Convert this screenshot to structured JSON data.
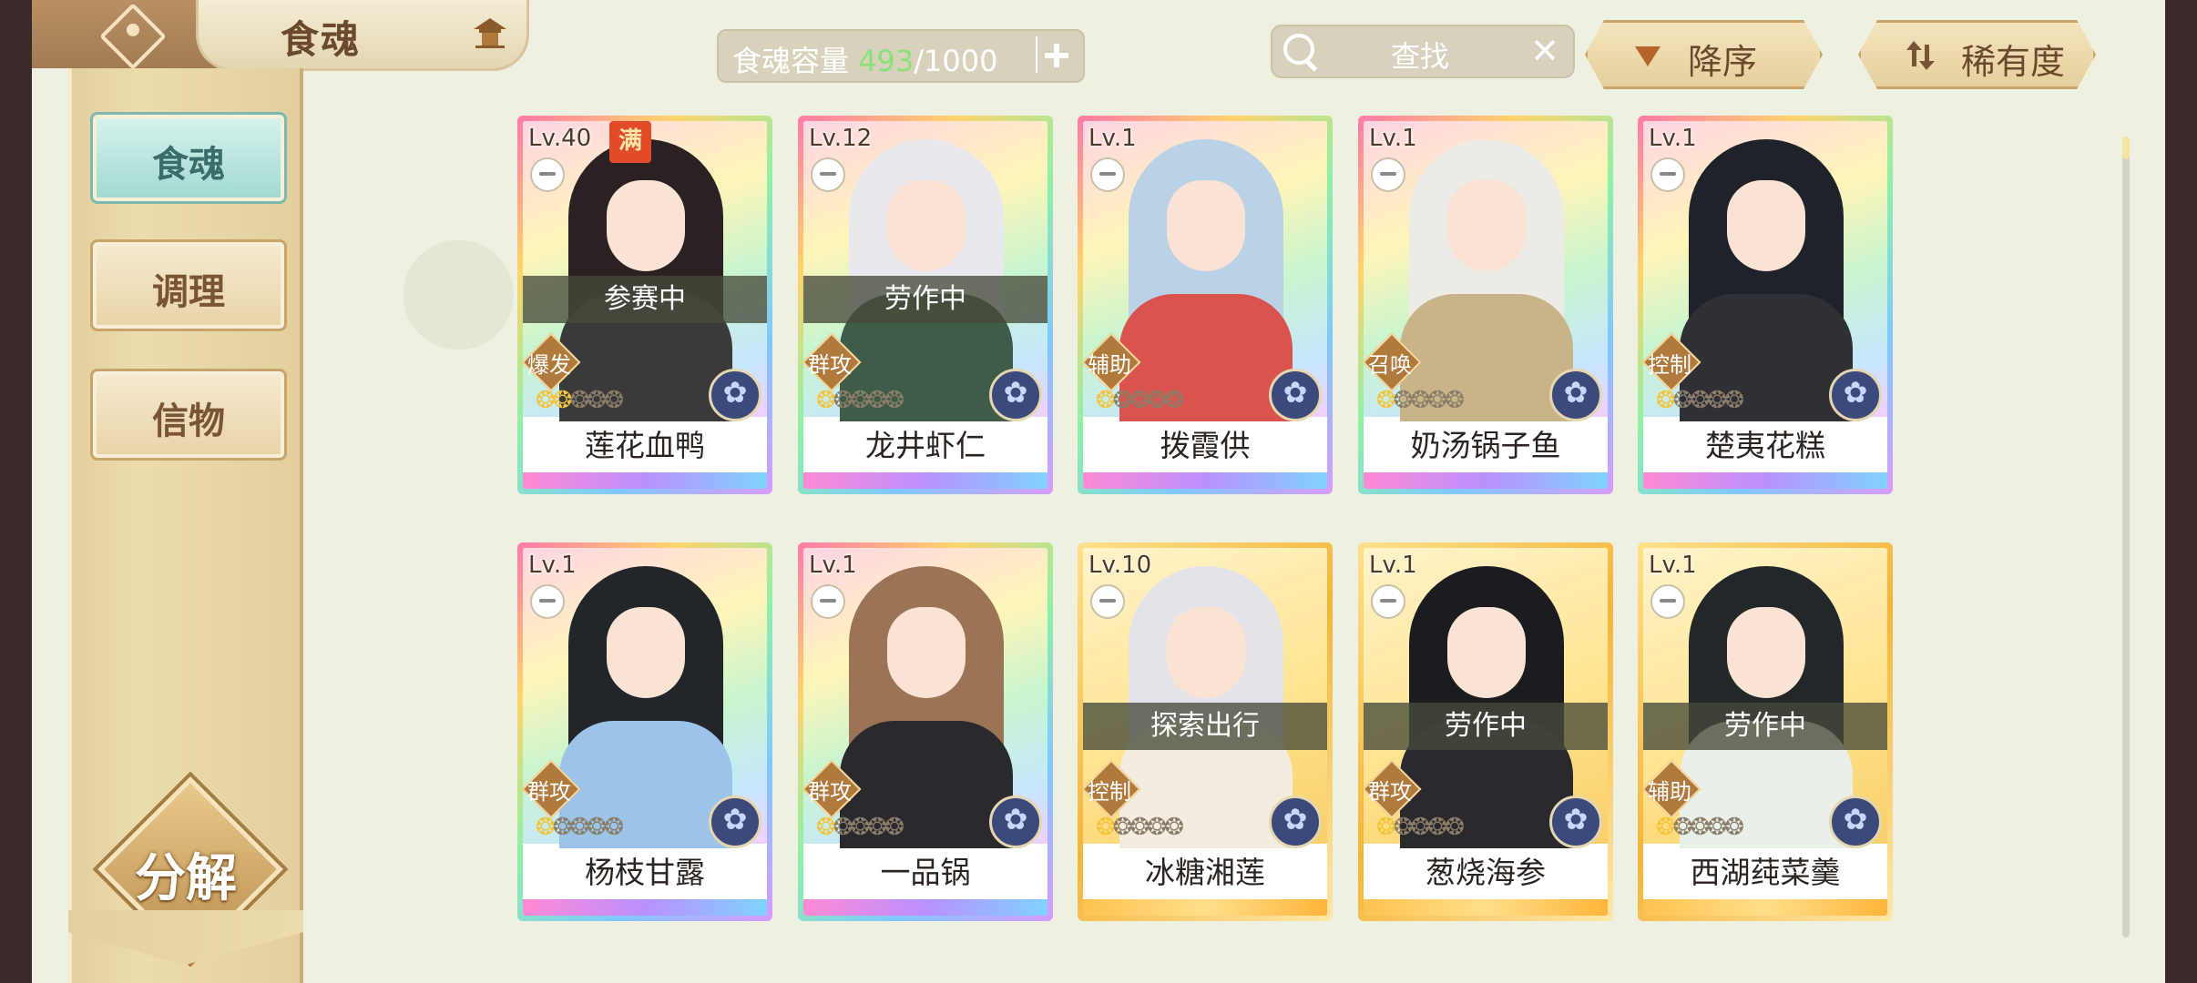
{
  "header": {
    "title": "食魂",
    "capacity_label": "食魂容量",
    "capacity_current": "493",
    "capacity_max": "/1000",
    "search_placeholder": "查找",
    "sort_order": "降序",
    "sort_by": "稀有度"
  },
  "sidebar": {
    "items": [
      {
        "label": "食魂",
        "active": true
      },
      {
        "label": "调理",
        "active": false
      },
      {
        "label": "信物",
        "active": false
      }
    ],
    "decompose": "分解"
  },
  "cards": [
    {
      "level": "Lv.40",
      "max_badge": "满",
      "status": "参赛中",
      "role": "爆发",
      "stars": 2,
      "name": "莲花血鸭",
      "frame": "rainbow",
      "hair": "#2a2222",
      "body": "#3a3a3a"
    },
    {
      "level": "Lv.12",
      "status": "劳作中",
      "role": "群攻",
      "stars": 1,
      "name": "龙井虾仁",
      "frame": "rainbow",
      "hair": "#e8e8ee",
      "body": "#3f5c48"
    },
    {
      "level": "Lv.1",
      "status": "",
      "role": "辅助",
      "stars": 1,
      "name": "拨霞供",
      "frame": "rainbow",
      "hair": "#b9d2e6",
      "body": "#d9534f"
    },
    {
      "level": "Lv.1",
      "status": "",
      "role": "召唤",
      "stars": 1,
      "name": "奶汤锅子鱼",
      "frame": "rainbow",
      "hair": "#ecebe6",
      "body": "#c9b48a"
    },
    {
      "level": "Lv.1",
      "status": "",
      "role": "控制",
      "stars": 1,
      "name": "楚夷花糕",
      "frame": "rainbow",
      "hair": "#1f2228",
      "body": "#2e3036"
    },
    {
      "level": "Lv.1",
      "status": "",
      "role": "群攻",
      "stars": 1,
      "name": "杨枝甘露",
      "frame": "rainbow",
      "hair": "#22252a",
      "body": "#9bc4e8"
    },
    {
      "level": "Lv.1",
      "status": "",
      "role": "群攻",
      "stars": 1,
      "name": "一品锅",
      "frame": "rainbow",
      "hair": "#9b7355",
      "body": "#2a2a2e"
    },
    {
      "level": "Lv.10",
      "status": "探索出行",
      "role": "控制",
      "stars": 1,
      "name": "冰糖湘莲",
      "frame": "gold",
      "hair": "#e2e4ea",
      "body": "#f3ece0"
    },
    {
      "level": "Lv.1",
      "status": "劳作中",
      "role": "群攻",
      "stars": 1,
      "name": "葱烧海参",
      "frame": "gold",
      "hair": "#1c1c20",
      "body": "#2a2a2e"
    },
    {
      "level": "Lv.1",
      "status": "劳作中",
      "role": "辅助",
      "stars": 1,
      "name": "西湖莼菜羹",
      "frame": "gold",
      "hair": "#22282a",
      "body": "#e8f0e8"
    }
  ],
  "colors": {
    "accent_teal": "#9ed9d0",
    "gold": "#e5cf9d",
    "capacity_green": "#8be07a"
  }
}
